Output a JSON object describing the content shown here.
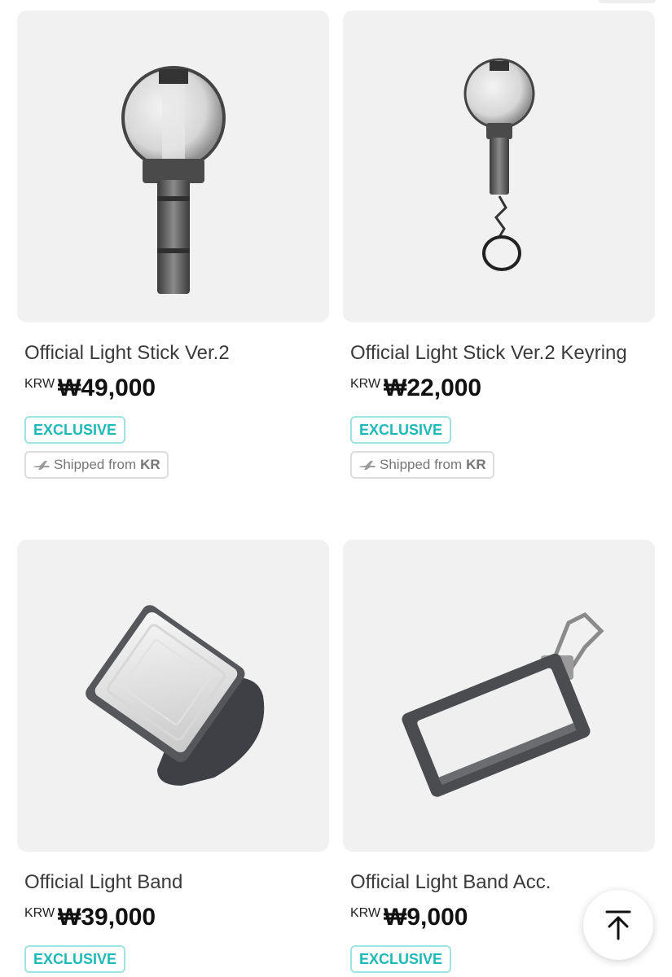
{
  "products": [
    {
      "name": "Official Light Stick Ver.2",
      "currency": "KRW",
      "price": "₩49,000",
      "badge": "EXCLUSIVE",
      "shipping_label": "Shipped from",
      "shipping_country": "KR",
      "image_icon": "light-stick-icon"
    },
    {
      "name": "Official Light Stick Ver.2 Keyring",
      "currency": "KRW",
      "price": "₩22,000",
      "badge": "EXCLUSIVE",
      "shipping_label": "Shipped from",
      "shipping_country": "KR",
      "image_icon": "light-stick-keyring-icon"
    },
    {
      "name": "Official Light Band",
      "currency": "KRW",
      "price": "₩39,000",
      "badge": "EXCLUSIVE",
      "image_icon": "light-band-icon"
    },
    {
      "name": "Official Light Band Acc.",
      "currency": "KRW",
      "price": "₩9,000",
      "badge": "EXCLUSIVE",
      "image_icon": "light-band-accessory-icon"
    }
  ],
  "scroll_top_icon": "arrow-up-to-top-icon",
  "colors": {
    "badge_text": "#1fb9b6",
    "badge_border": "#9fe3e2",
    "thumb_bg": "#f1f1f1"
  }
}
